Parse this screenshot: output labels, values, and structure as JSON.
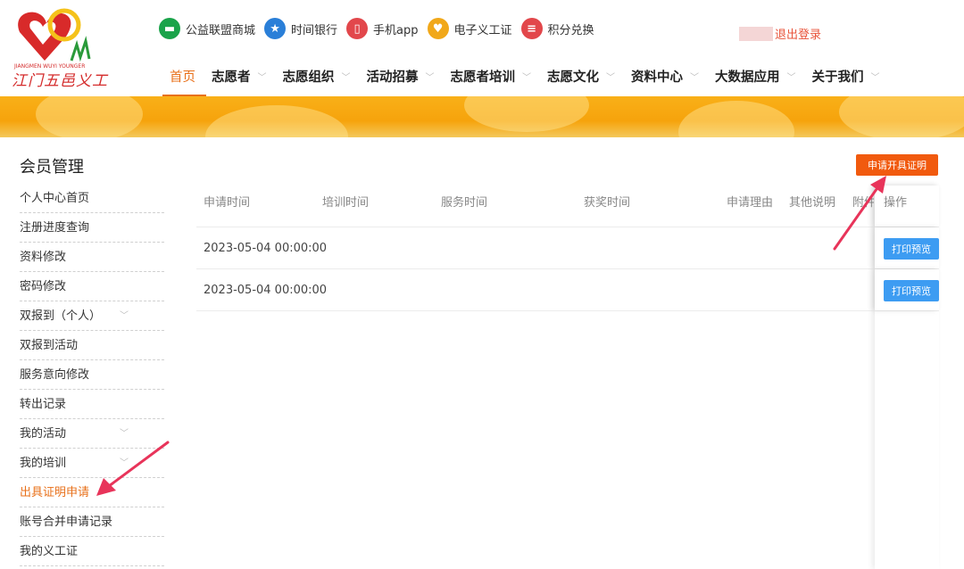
{
  "logo": {
    "text": "江门五邑义工",
    "subtext": "JIANGMEN WUYI YOUNGER"
  },
  "quicklinks": [
    {
      "label": "公益联盟商城",
      "icon": "shop-icon",
      "color": "#1aa34a"
    },
    {
      "label": "时间银行",
      "icon": "star-icon",
      "color": "#2a7fd8"
    },
    {
      "label": "手机app",
      "icon": "phone-icon",
      "color": "#e2474b"
    },
    {
      "label": "电子义工证",
      "icon": "heart-badge-icon",
      "color": "#f1a81a"
    },
    {
      "label": "积分兑换",
      "icon": "coins-icon",
      "color": "#e2474b"
    }
  ],
  "user": {
    "logout_label": "退出登录"
  },
  "nav": [
    {
      "label": "首页",
      "active": true,
      "dropdown": false
    },
    {
      "label": "志愿者",
      "active": false,
      "dropdown": true
    },
    {
      "label": "志愿组织",
      "active": false,
      "dropdown": true
    },
    {
      "label": "活动招募",
      "active": false,
      "dropdown": true
    },
    {
      "label": "志愿者培训",
      "active": false,
      "dropdown": true
    },
    {
      "label": "志愿文化",
      "active": false,
      "dropdown": true
    },
    {
      "label": "资料中心",
      "active": false,
      "dropdown": true
    },
    {
      "label": "大数据应用",
      "active": false,
      "dropdown": true
    },
    {
      "label": "关于我们",
      "active": false,
      "dropdown": true
    }
  ],
  "sidebar": {
    "title": "会员管理",
    "items": [
      {
        "label": "个人中心首页",
        "caret": false
      },
      {
        "label": "注册进度查询",
        "caret": false
      },
      {
        "label": "资料修改",
        "caret": false
      },
      {
        "label": "密码修改",
        "caret": false
      },
      {
        "label": "双报到（个人）",
        "caret": true
      },
      {
        "label": "双报到活动",
        "caret": false
      },
      {
        "label": "服务意向修改",
        "caret": false
      },
      {
        "label": "转出记录",
        "caret": false
      },
      {
        "label": "我的活动",
        "caret": true
      },
      {
        "label": "我的培训",
        "caret": true
      },
      {
        "label": "出具证明申请",
        "caret": false,
        "active": true
      },
      {
        "label": "账号合并申请记录",
        "caret": false
      },
      {
        "label": "我的义工证",
        "caret": false
      }
    ]
  },
  "actions": {
    "apply_label": "申请开具证明"
  },
  "table": {
    "columns": [
      "申请时间",
      "培训时间",
      "服务时间",
      "获奖时间",
      "申请理由",
      "其他说明",
      "附件",
      "操作"
    ],
    "rows": [
      {
        "apply_time": "2023-05-04 00:00:00",
        "action_label": "打印预览"
      },
      {
        "apply_time": "2023-05-04 00:00:00",
        "action_label": "打印预览"
      }
    ]
  },
  "colors": {
    "accent": "#e8701a",
    "apply_button": "#f15a0e",
    "print_button": "#3d9cf2",
    "annotation_arrow": "#e8345a"
  }
}
